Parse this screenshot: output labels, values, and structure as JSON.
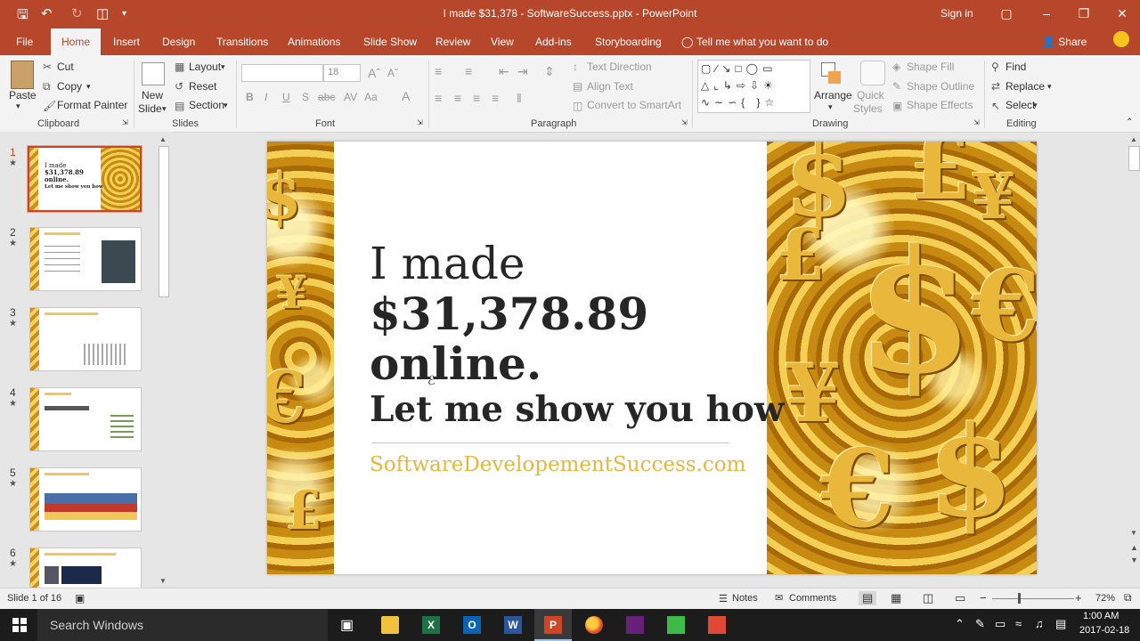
{
  "window": {
    "title": "I made $31,378 - SoftwareSuccess.pptx - PowerPoint",
    "sign_in": "Sign in"
  },
  "tabs": {
    "file": "File",
    "home": "Home",
    "insert": "Insert",
    "design": "Design",
    "transitions": "Transitions",
    "animations": "Animations",
    "slideshow": "Slide Show",
    "review": "Review",
    "view": "View",
    "addins": "Add-ins",
    "storyboarding": "Storyboarding",
    "tell_me": "Tell me what you want to do",
    "share": "Share"
  },
  "ribbon": {
    "clipboard": {
      "paste": "Paste",
      "cut": "Cut",
      "copy": "Copy",
      "format_painter": "Format Painter",
      "label": "Clipboard"
    },
    "slides": {
      "new_slide_1": "New",
      "new_slide_2": "Slide",
      "layout": "Layout",
      "reset": "Reset",
      "section": "Section",
      "label": "Slides"
    },
    "font": {
      "name_value": "",
      "size_value": "18",
      "label": "Font"
    },
    "paragraph": {
      "text_direction": "Text Direction",
      "align_text": "Align Text",
      "convert_smartart": "Convert to SmartArt",
      "label": "Paragraph"
    },
    "drawing": {
      "arrange": "Arrange",
      "quick_styles_1": "Quick",
      "quick_styles_2": "Styles",
      "shape_fill": "Shape Fill",
      "shape_outline": "Shape Outline",
      "shape_effects": "Shape Effects",
      "label": "Drawing"
    },
    "editing": {
      "find": "Find",
      "replace": "Replace",
      "select": "Select",
      "label": "Editing"
    }
  },
  "thumbnails": [
    {
      "num": "1",
      "selected": true
    },
    {
      "num": "2",
      "selected": false
    },
    {
      "num": "3",
      "selected": false
    },
    {
      "num": "4",
      "selected": false
    },
    {
      "num": "5",
      "selected": false
    },
    {
      "num": "6",
      "selected": false
    }
  ],
  "slide": {
    "line1": "I made",
    "line2": "$31,378.89",
    "line3": "online.",
    "line4": "Let me show you how",
    "url": "SoftwareDevelopementSuccess.com"
  },
  "thumb1": {
    "l1": "I made",
    "l2": "$31,378.89",
    "l3": "online.",
    "l4": "Let me show you how"
  },
  "status": {
    "slide_of": "Slide 1 of 16",
    "notes": "Notes",
    "comments": "Comments",
    "zoom": "72%"
  },
  "taskbar": {
    "search": "Search Windows",
    "time": "1:00 AM",
    "date": "2017-02-18"
  },
  "colors": {
    "accent": "#b7472a",
    "slide_url": "#e6b73a",
    "gold": "#d9a22a"
  }
}
